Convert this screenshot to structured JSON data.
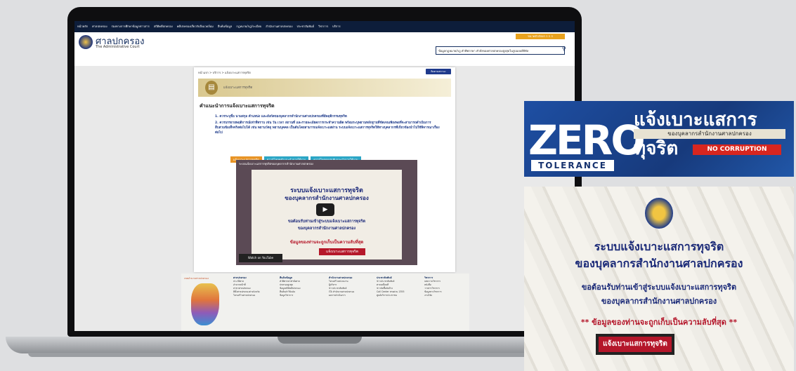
{
  "site": {
    "nav_items": [
      "หน้าหลัก",
      "ศาลปกครอง",
      "ร่องทางการศึกษาข้อมูลข่าวสาร",
      "สถิติคดีปกครอง",
      "คดีปกครองเกี่ยวกับสิ่งแวดล้อม",
      "สืบค้นข้อมูล",
      "กฎหมาย/กฎ/ระเบียบ",
      "สำนักงานศาลปกครอง",
      "ประชาสัมพันธ์",
      "วิชาการ",
      "บริการ"
    ],
    "name_th": "ศาลปกครอง",
    "name_en": "The Administrative Court",
    "lang_box": "ขนาดตัวอักษร  ก ก ก",
    "search_placeholder": "ข้อมูลกฎหมาย/กฎ คำพิพากษา คำสั่งของศาลปกครองสูงสุดในรูปแบบดิจิทัล"
  },
  "page": {
    "breadcrumb": "หน้าแรก  >  บริการ  >  แจ้งเบาะแสการทุจริต",
    "sitemap_button": "ติดตามสถานะ",
    "banner_title": "แจ้งเบาะแสการทุจริต",
    "heading": "คำแนะนำการแจ้งเบาะแสการทุจริต",
    "rule1": "1. ควรระบุชื่อ นามสกุล ตำแหน่ง และสังกัดของบุคลากรสำนักงานศาลปกครองที่มีพฤติกรรมทุจริต",
    "rule2": "2. ควรบรรยายพฤติการณ์เท่าที่ทราบ เช่น วัน เวลา สถานที่ และรายละเอียดการกระทำความผิด พร้อมระบุพยานหลักฐานที่ชัดเจนเพียงพอที่จะสามารถดำเนินการสืบสวนข้อเท็จจริงต่อไปได้ เช่น พยานวัตถุ พยานบุคคล เป็นต้นโดยสามารถแจ้งเบาะแสผ่าน ระบบแจ้งเบาะแสการทุจริตให้ทางบุคลากรที่เกี่ยวข้องนำไปใช้พิจารณาเรื่องต่อไป",
    "buttons": [
      {
        "label": "แจ้งเบาะแสการทุจริต",
        "color": "#e89425"
      },
      {
        "label": "ดาวน์โหลดคำแนะนำการใช้งาน",
        "color": "#2ba6c6"
      },
      {
        "label": "ดาวน์โหลดแผ่นพับแนะนำการใช้งาน",
        "color": "#2ba6c6"
      }
    ],
    "video": {
      "title": "ระบบแจ้งเบาะแสการทุจริตของบุคลากรสำนักงานศาลปกครอง",
      "line1": "ระบบแจ้งเบาะแสการทุจริต",
      "line2": "ของบุคลากรสำนักงานศาลปกครอง",
      "line3": "ขอต้อนรับท่านเข้าสู่ระบบแจ้งเบาะแสการทุจริต",
      "line4": "ของบุคลากรสำนักงานศาลปกครอง",
      "line5": "ข้อมูลของท่านจะถูกเก็บเป็นความลับที่สุด",
      "cta": "แจ้งเบาะแสการทุจริต",
      "watch_on": "Watch on  YouTube"
    }
  },
  "footer": {
    "map_label": "เขตอำนาจศาลปกครอง",
    "columns": [
      {
        "title": "ศาลปกครอง",
        "items": [
          "ประวัติศาล",
          "อำนาจหน้าที่",
          "สาขาศาลปกครอง",
          "ที่ตั้งศาลปกครองต่างจังหวัด",
          "โครงสร้างศาลปกครอง"
        ]
      },
      {
        "title": "สืบค้นข้อมูล",
        "items": [
          "คำพิพากษาคำสั่งศาล",
          "ปกครองสูงสุด",
          "ข้อมูลสถิติคดีปกครอง",
          "สืบค้นคำวินิจฉัย",
          "ข้อมูลวิชาการ"
        ]
      },
      {
        "title": "สำนักงานศาลปกครอง",
        "items": [
          "โครงสร้างหน่วยงาน",
          "ผู้บริหาร",
          "ข่าวประชาสัมพันธ์",
          "ITA สำนักงานศาลปกครอง",
          "ผลการดำเนินการ"
        ]
      },
      {
        "title": "ประชาสัมพันธ์",
        "items": [
          "ข่าวประชาสัมพันธ์",
          "ศาลเคลื่อนที่",
          "ข่าวจัดซื้อจัดจ้าง",
          "Call Center สายด่วน 1355",
          "ศูนย์บริการประชาชน"
        ]
      },
      {
        "title": "วิชาการ",
        "items": [
          "บทความวิชาการ",
          "หนังสือ",
          "วารสารวิชาการ",
          "ข้อมูลทางวิชาการ",
          "งานวิจัย"
        ]
      }
    ]
  },
  "poster_top": {
    "title": "แจ้งเบาะแสการทุจริต",
    "subtitle": "ของบุคลากรสำนักงานศาลปกครอง",
    "badge": "NO CORRUPTION",
    "zero": "ZERO",
    "tolerance": "TOLERANCE"
  },
  "poster_bottom": {
    "line1": "ระบบแจ้งเบาะแสการทุจริต",
    "line2": "ของบุคลากรสำนักงานศาลปกครอง",
    "line3": "ขอต้อนรับท่านเข้าสู่ระบบแจ้งเบาะแสการทุจริต",
    "line4": "ของบุคลากรสำนักงานศาลปกครอง",
    "line5": "** ข้อมูลของท่านจะถูกเก็บเป็นความลับที่สุด **",
    "cta": "แจ้งเบาะแสการทุจริต"
  }
}
